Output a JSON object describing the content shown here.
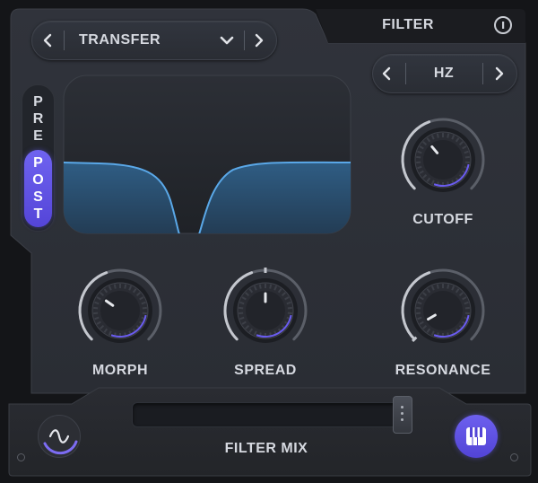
{
  "header": {
    "title": "FILTER"
  },
  "preset": {
    "name": "TRANSFER"
  },
  "unit": {
    "value": "HZ"
  },
  "prepost": {
    "pre": [
      "P",
      "R",
      "E"
    ],
    "post": [
      "P",
      "O",
      "S",
      "T"
    ]
  },
  "knobs": {
    "cutoff": "CUTOFF",
    "morph": "MORPH",
    "spread": "SPREAD",
    "resonance": "RESONANCE"
  },
  "mix": {
    "label": "FILTER MIX",
    "value": 0.95
  },
  "colors": {
    "accent": "#6a5cf0",
    "curve": "#5aa8e8",
    "panel": "#2b2e35"
  },
  "icons": [
    "info-icon",
    "chevron-left-icon",
    "chevron-right-icon",
    "chevron-down-icon",
    "sine-wave-icon",
    "piano-keys-icon"
  ]
}
